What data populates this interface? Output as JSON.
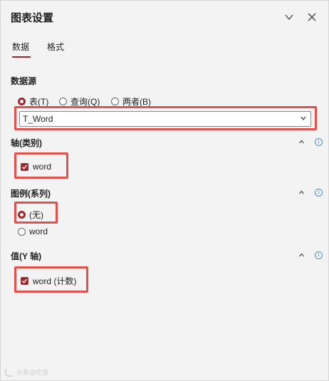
{
  "panel": {
    "title": "图表设置"
  },
  "tabs": [
    {
      "label": "数据",
      "active": true
    },
    {
      "label": "格式",
      "active": false
    }
  ],
  "data_source": {
    "heading": "数据源",
    "options": [
      {
        "label": "表(T)",
        "selected": true
      },
      {
        "label": "查询(Q)",
        "selected": false
      },
      {
        "label": "两者(B)",
        "selected": false
      }
    ],
    "select_value": "T_Word"
  },
  "axis": {
    "heading": "轴(类别)",
    "items": [
      {
        "label": "word",
        "checked": true
      }
    ]
  },
  "legend": {
    "heading": "图例(系列)",
    "options": [
      {
        "label": "(无)",
        "selected": true
      },
      {
        "label": "word",
        "selected": false
      }
    ]
  },
  "values": {
    "heading": "值(Y 轴)",
    "items": [
      {
        "label": "word (计数)",
        "checked": true
      }
    ]
  },
  "watermark": {
    "text": "头条@吃饭"
  },
  "colors": {
    "accent": "#a4262c",
    "highlight": "#e0524e",
    "info": "#4a8fd8"
  }
}
